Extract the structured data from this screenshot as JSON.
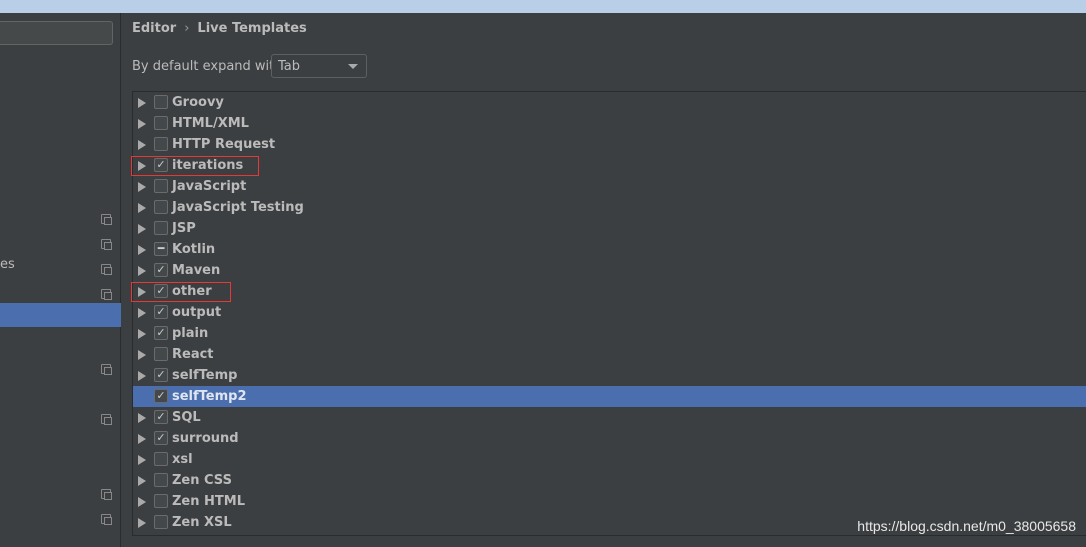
{
  "breadcrumb": {
    "parent": "Editor",
    "separator": "›",
    "current": "Live Templates"
  },
  "expand": {
    "label": "By default expand with",
    "value": "Tab"
  },
  "sidebar": {
    "partial_text": "es"
  },
  "templates": [
    {
      "label": "Groovy",
      "state": "unchecked"
    },
    {
      "label": "HTML/XML",
      "state": "unchecked"
    },
    {
      "label": "HTTP Request",
      "state": "unchecked"
    },
    {
      "label": "iterations",
      "state": "checked",
      "highlighted": true
    },
    {
      "label": "JavaScript",
      "state": "unchecked"
    },
    {
      "label": "JavaScript Testing",
      "state": "unchecked"
    },
    {
      "label": "JSP",
      "state": "unchecked"
    },
    {
      "label": "Kotlin",
      "state": "partial"
    },
    {
      "label": "Maven",
      "state": "checked"
    },
    {
      "label": "other",
      "state": "checked",
      "highlighted": true
    },
    {
      "label": "output",
      "state": "checked"
    },
    {
      "label": "plain",
      "state": "checked"
    },
    {
      "label": "React",
      "state": "unchecked"
    },
    {
      "label": "selfTemp",
      "state": "checked"
    },
    {
      "label": "selfTemp2",
      "state": "checked",
      "selected": true,
      "leaf": true
    },
    {
      "label": "SQL",
      "state": "checked"
    },
    {
      "label": "surround",
      "state": "checked"
    },
    {
      "label": "xsl",
      "state": "unchecked"
    },
    {
      "label": "Zen CSS",
      "state": "unchecked"
    },
    {
      "label": "Zen HTML",
      "state": "unchecked"
    },
    {
      "label": "Zen XSL",
      "state": "unchecked"
    }
  ],
  "colors": {
    "selection": "#4b6eaf",
    "highlight_box": "#e53935",
    "background": "#3c3f41"
  },
  "watermark": "https://blog.csdn.net/m0_38005658"
}
